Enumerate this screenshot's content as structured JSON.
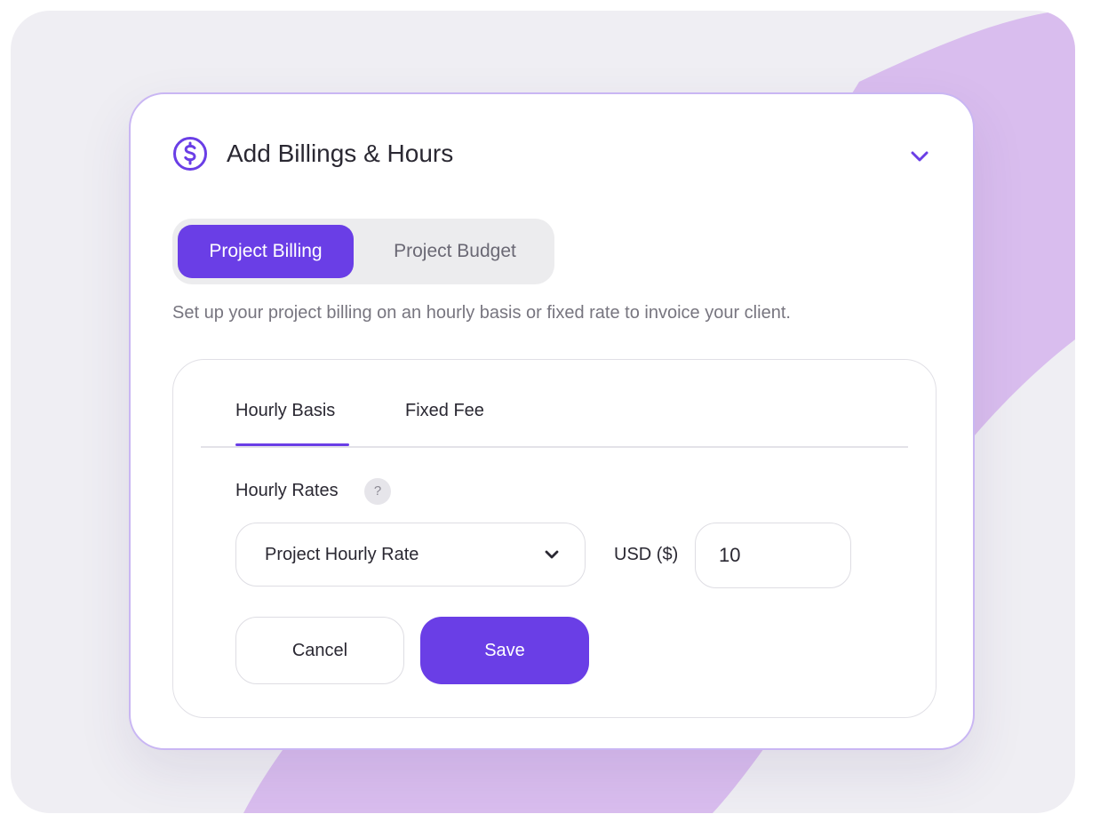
{
  "header": {
    "title": "Add Billings & Hours",
    "icon": "dollar-circle-icon",
    "collapse_icon": "chevron-down-icon"
  },
  "billing_tabs": {
    "items": [
      {
        "label": "Project Billing",
        "active": true
      },
      {
        "label": "Project Budget",
        "active": false
      }
    ]
  },
  "subtitle": "Set up your project billing on an hourly basis or fixed rate to invoice your client.",
  "rate_tabs": {
    "items": [
      {
        "label": "Hourly Basis",
        "active": true
      },
      {
        "label": "Fixed Fee",
        "active": false
      }
    ]
  },
  "rates": {
    "label": "Hourly Rates",
    "help_glyph": "?",
    "select_value": "Project Hourly Rate",
    "currency_label": "USD ($)",
    "amount_value": "10"
  },
  "actions": {
    "cancel_label": "Cancel",
    "save_label": "Save"
  },
  "colors": {
    "accent": "#6a3ee6",
    "card_border": "#c9b6f3",
    "background": "#efeef3",
    "swoosh": "#d6b7ea"
  }
}
